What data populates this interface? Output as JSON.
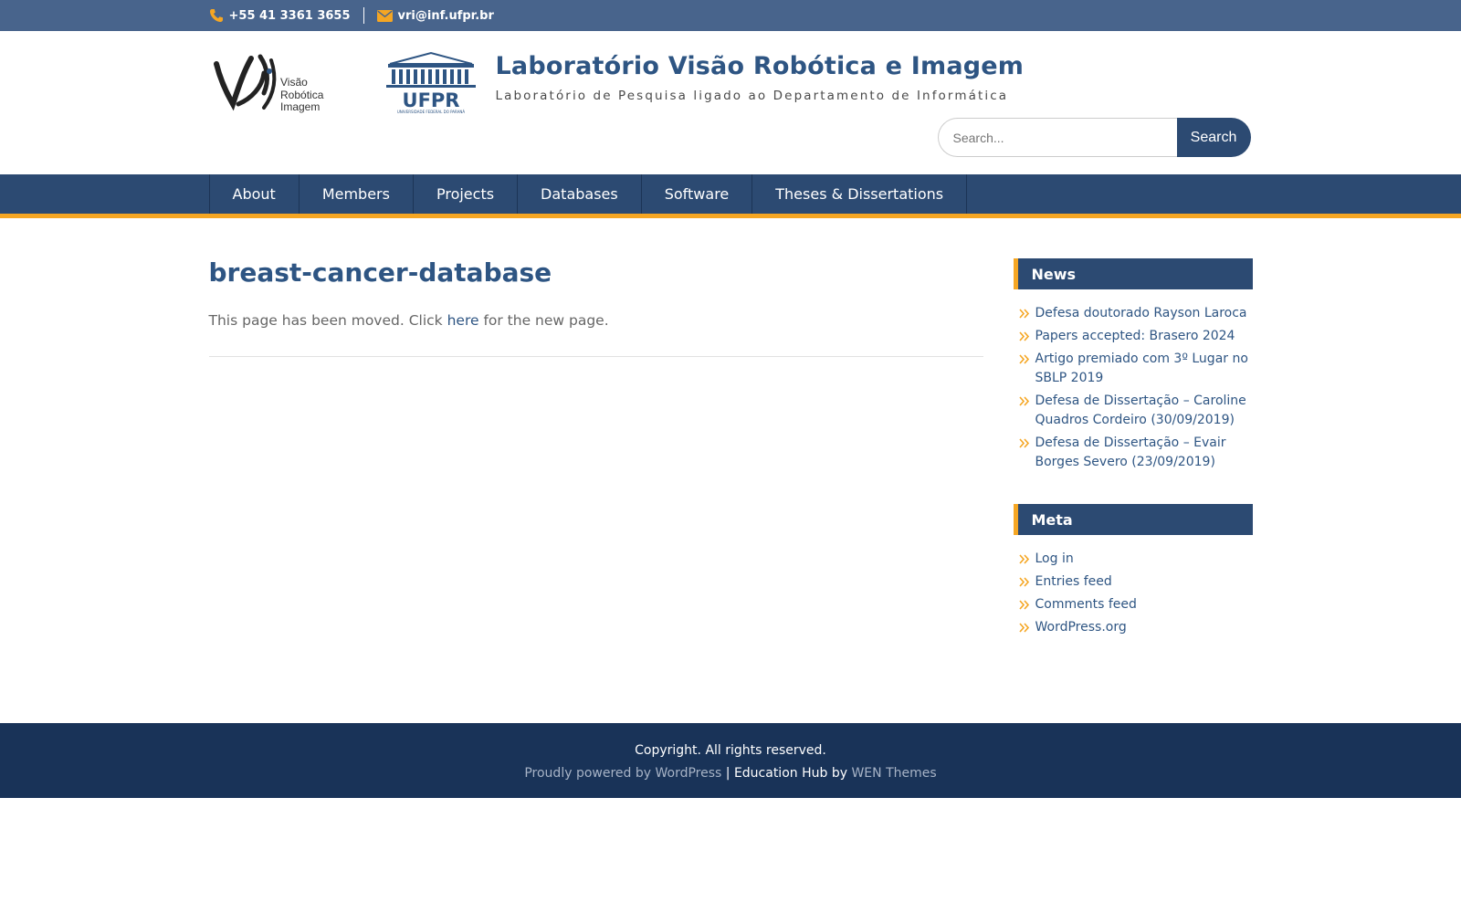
{
  "topbar": {
    "phone": "+55 41 3361 3655",
    "email": "vri@inf.ufpr.br",
    "phone_icon": "phone-icon",
    "email_icon": "envelope-icon"
  },
  "header": {
    "logo_text_1": "Visão",
    "logo_text_2": "Robótica",
    "logo_text_3": "Imagem",
    "ufpr_text": "UFPR",
    "ufpr_subtext": "UNIVERSIDADE FEDERAL DO PARANÁ",
    "title": "Laboratório Visão Robótica e Imagem",
    "tagline": "Laboratório de Pesquisa ligado ao Departamento de Informática",
    "search_placeholder": "Search...",
    "search_button": "Search"
  },
  "nav": {
    "items": [
      {
        "label": "About"
      },
      {
        "label": "Members"
      },
      {
        "label": "Projects"
      },
      {
        "label": "Databases"
      },
      {
        "label": "Software"
      },
      {
        "label": "Theses & Dissertations"
      }
    ]
  },
  "main": {
    "title": "breast-cancer-database",
    "text_before": "This page has been moved. Click ",
    "link_text": "here",
    "text_after": " for the new page."
  },
  "sidebar": {
    "news": {
      "title": "News",
      "items": [
        {
          "label": "Defesa doutorado Rayson Laroca"
        },
        {
          "label": "Papers accepted: Brasero 2024"
        },
        {
          "label": "Artigo premiado com 3º Lugar no SBLP 2019"
        },
        {
          "label": "Defesa de Dissertação – Caroline Quadros Cordeiro (30/09/2019)"
        },
        {
          "label": "Defesa de Dissertação – Evair Borges Severo (23/09/2019)"
        }
      ]
    },
    "meta": {
      "title": "Meta",
      "items": [
        {
          "label": "Log in"
        },
        {
          "label": "Entries feed"
        },
        {
          "label": "Comments feed"
        },
        {
          "label": "WordPress.org"
        }
      ]
    }
  },
  "footer": {
    "copyright": "Copyright. All rights reserved.",
    "powered_by": "Proudly powered by WordPress",
    "separator": " | ",
    "theme_name": "Education Hub by ",
    "theme_author": "WEN Themes"
  },
  "colors": {
    "topbar": "#48648c",
    "nav": "#2c4a72",
    "accent": "#f5a623",
    "title": "#2e5583",
    "footer": "#193358"
  }
}
